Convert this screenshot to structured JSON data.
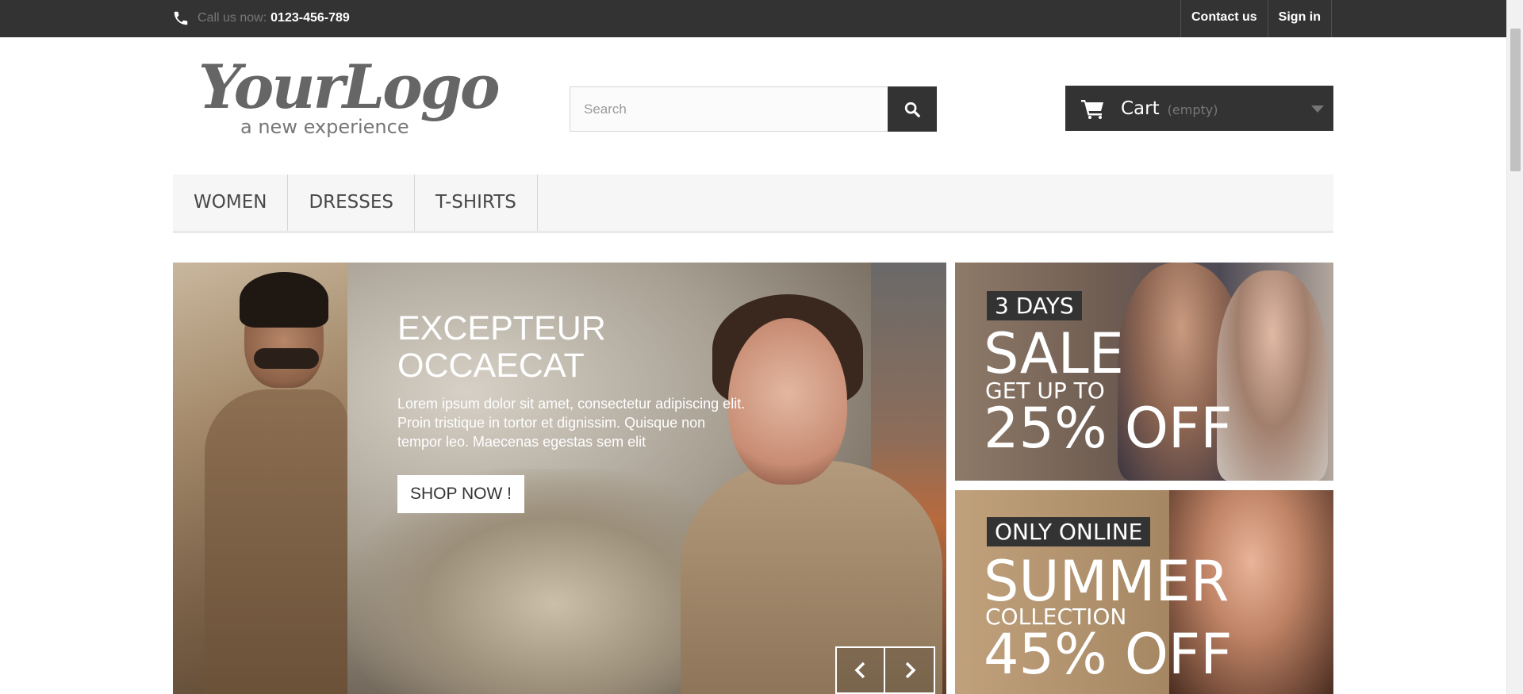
{
  "topbar": {
    "phone_label": "Call us now:",
    "phone_number": "0123-456-789",
    "contact_label": "Contact us",
    "signin_label": "Sign in"
  },
  "logo": {
    "text": "YourLogo",
    "tagline": "a new experience"
  },
  "search": {
    "placeholder": "Search"
  },
  "cart": {
    "label": "Cart",
    "status": "(empty)"
  },
  "menu": {
    "items": [
      "WOMEN",
      "DRESSES",
      "T-SHIRTS"
    ]
  },
  "slider": {
    "title": "EXCEPTEUR OCCAECAT",
    "description": "Lorem ipsum dolor sit amet, consectetur adipiscing elit. Proin tristique in tortor et dignissim. Quisque non tempor leo. Maecenas egestas sem elit",
    "button_label": "SHOP NOW !"
  },
  "banners": [
    {
      "tag": "3 DAYS",
      "headline": "SALE",
      "sub": "GET UP TO",
      "offer": "25% OFF"
    },
    {
      "tag": "ONLY ONLINE",
      "headline": "SUMMER",
      "sub": "COLLECTION",
      "offer": "45% OFF"
    }
  ],
  "colors": {
    "dark": "#333333",
    "menu_bg": "#f6f6f6",
    "muted": "#777777"
  }
}
